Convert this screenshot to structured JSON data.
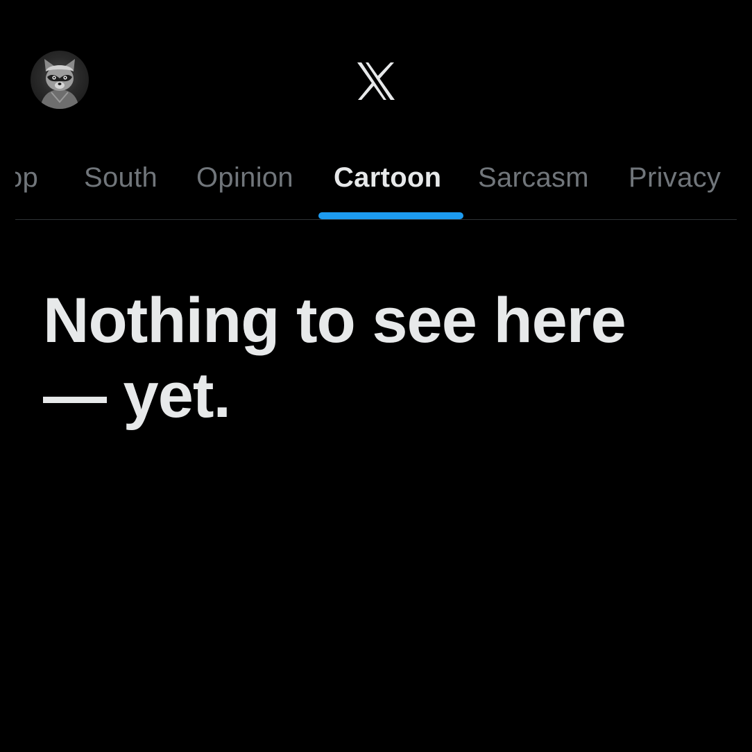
{
  "header": {
    "avatar_alt": "Profile avatar",
    "logo_icon": "x-logo-icon"
  },
  "tabs": {
    "items": [
      {
        "label": "op",
        "active": false
      },
      {
        "label": "South",
        "active": false
      },
      {
        "label": "Opinion",
        "active": false
      },
      {
        "label": "Cartoon",
        "active": true
      },
      {
        "label": "Sarcasm",
        "active": false
      },
      {
        "label": "Privacy",
        "active": false
      }
    ]
  },
  "main": {
    "empty_state_title": "Nothing to see here — yet."
  },
  "colors": {
    "background": "#000000",
    "text_primary": "#e7e9ea",
    "text_secondary": "#71767b",
    "accent": "#1d9bf0",
    "divider": "#2f3336"
  }
}
